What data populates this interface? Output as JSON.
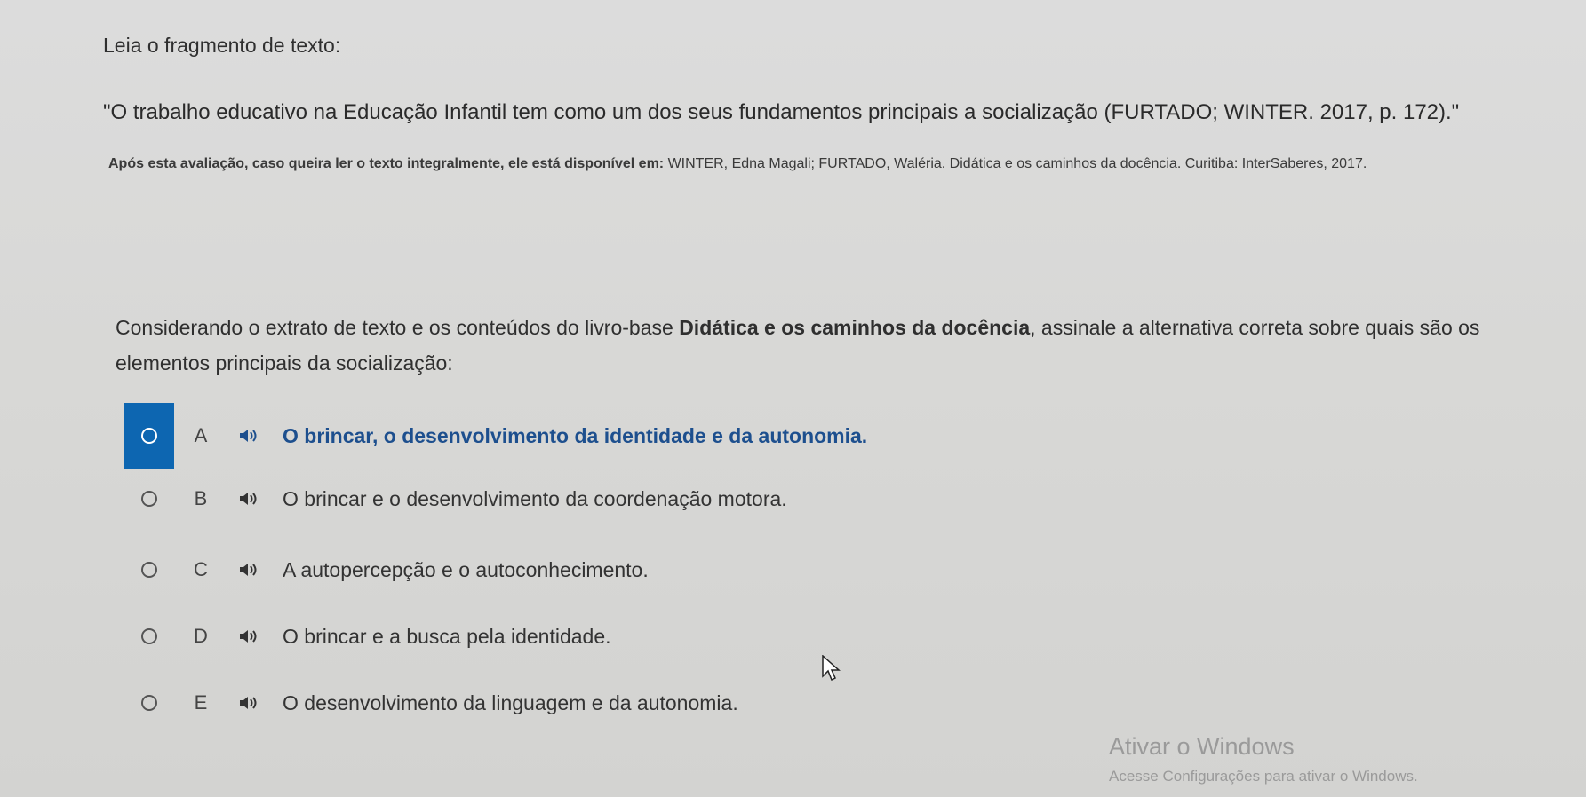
{
  "intro": "Leia o fragmento de texto:",
  "quote": "\"O trabalho educativo na Educação Infantil tem como um dos seus fundamentos principais a socialização (FURTADO; WINTER. 2017, p. 172).\"",
  "reference": {
    "prefix": "Após esta avaliação, caso queira ler o texto integralmente, ele está disponível em:",
    "citation": "WINTER, Edna Magali; FURTADO, Waléria. Didática e os caminhos da docência. Curitiba: InterSaberes, 2017."
  },
  "question": {
    "before": "Considerando o extrato de texto e os conteúdos do livro-base",
    "book": "Didática e os caminhos da docência",
    "after": ", assinale a alternativa correta sobre quais são os elementos principais da socialização:"
  },
  "options": [
    {
      "letter": "A",
      "text": "O brincar, o desenvolvimento da identidade e da autonomia.",
      "selected": true
    },
    {
      "letter": "B",
      "text": "O brincar e o desenvolvimento da coordenação motora.",
      "selected": false
    },
    {
      "letter": "C",
      "text": "A autopercepção e o autoconhecimento.",
      "selected": false
    },
    {
      "letter": "D",
      "text": "O brincar e a busca pela identidade.",
      "selected": false
    },
    {
      "letter": "E",
      "text": "O desenvolvimento da linguagem e da autonomia.",
      "selected": false
    }
  ],
  "watermark": {
    "title": "Ativar o Windows",
    "subtitle": "Acesse Configurações para ativar o Windows."
  },
  "colors": {
    "selected_bg": "#0d66b1",
    "selected_text": "#1d4f8e"
  }
}
